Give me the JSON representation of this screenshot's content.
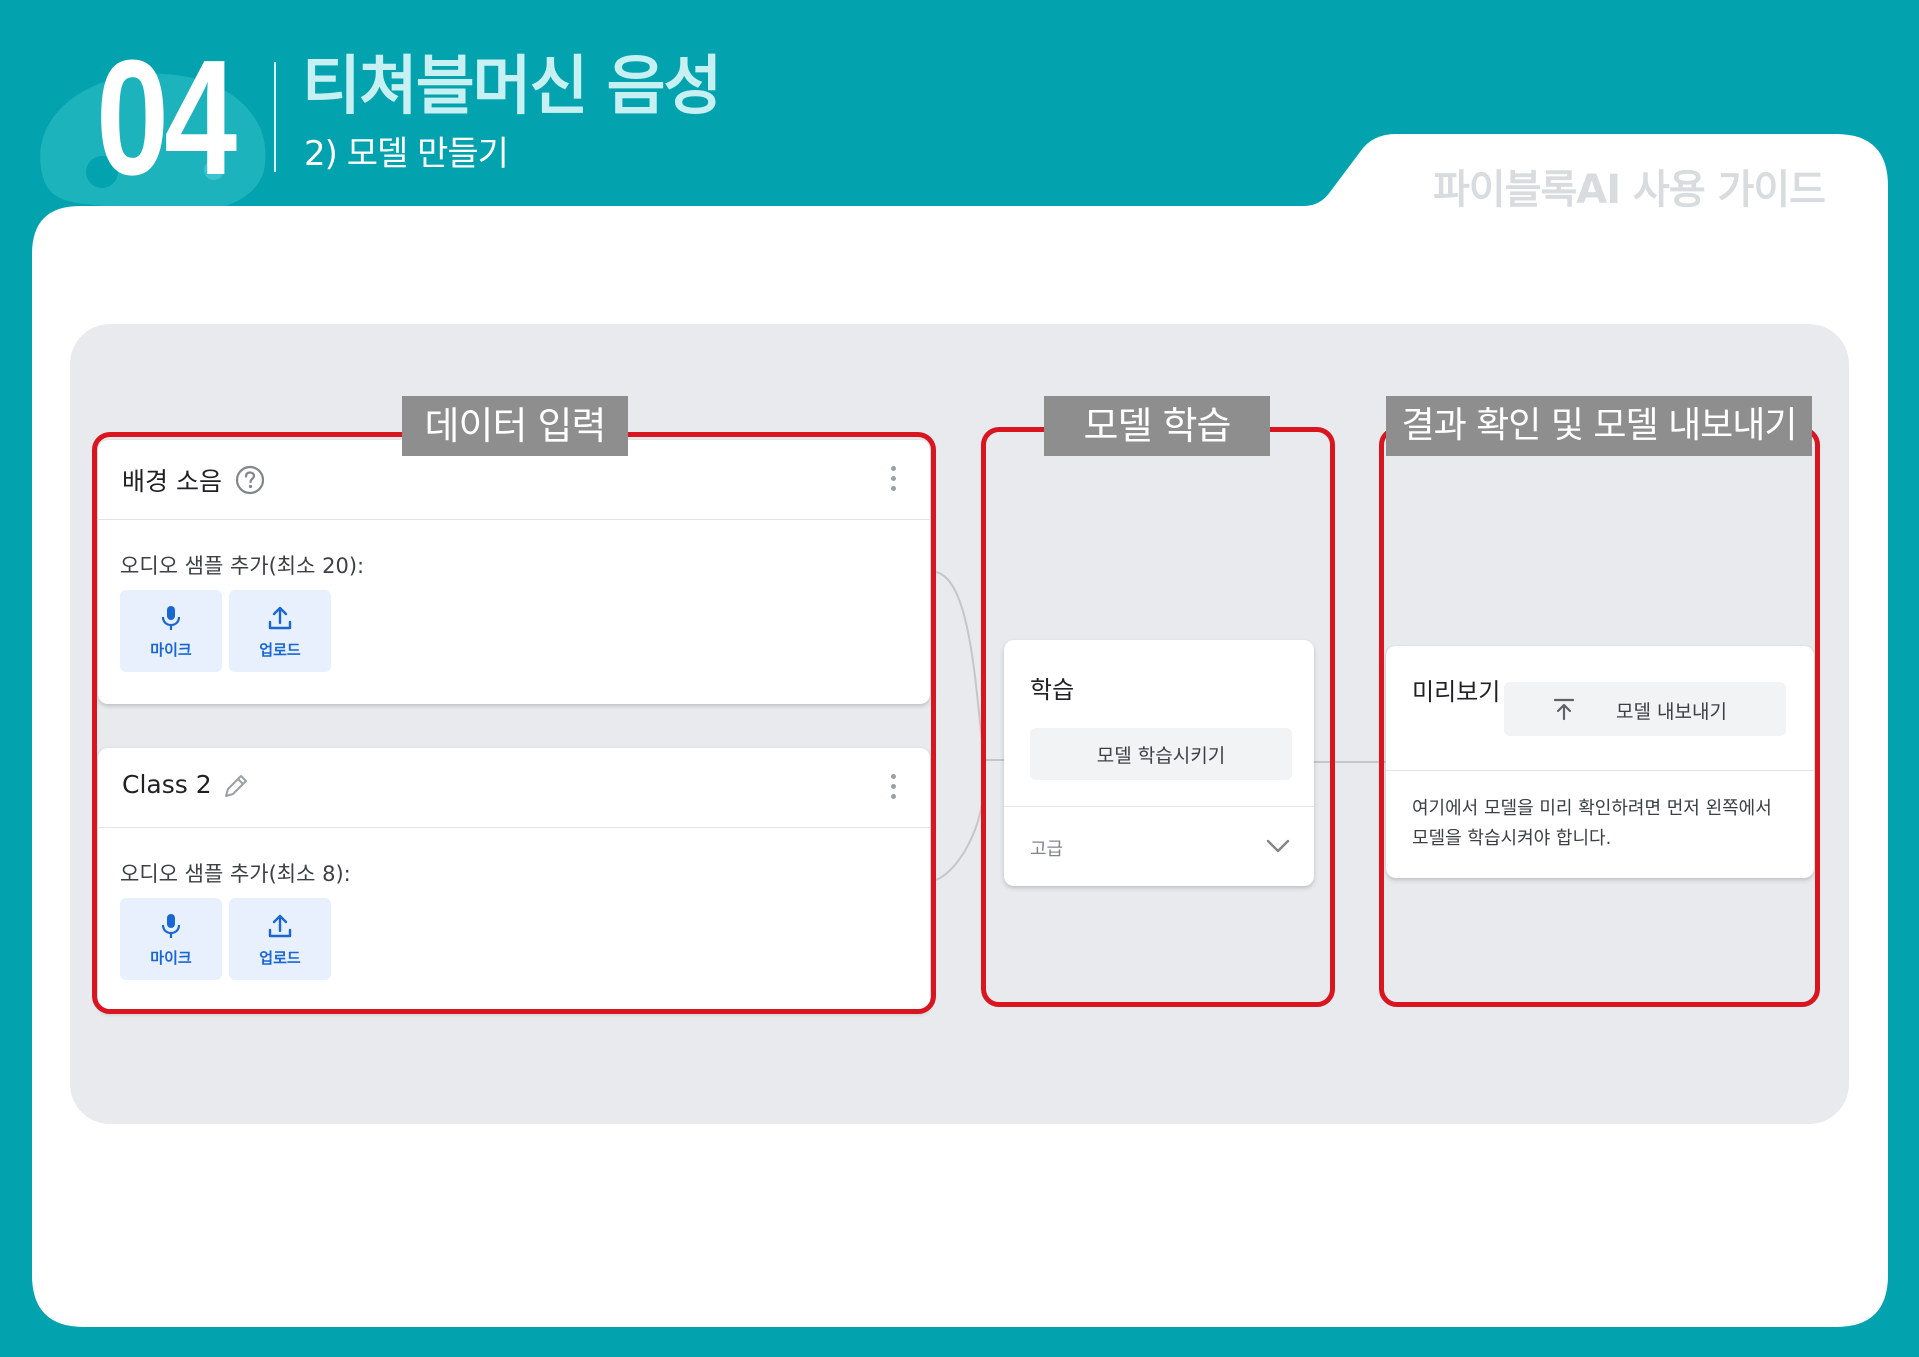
{
  "header": {
    "chapter_number": "04",
    "title": "티쳐블머신 음성",
    "subtitle": "2) 모델 만들기",
    "guide_label": "파이블록AI 사용 가이드"
  },
  "colors": {
    "background": "#02a2ae",
    "highlight_frame": "#d9151f",
    "label_box": "#8e8e8e",
    "button_accent": "#1967d2"
  },
  "sections": {
    "data_input": "데이터 입력",
    "training": "모델 학습",
    "result": "결과 확인 및 모델 내보내기"
  },
  "classes": [
    {
      "name": "배경 소음",
      "name_icon": "help-circle-icon",
      "sample_label": "오디오 샘플 추가(최소 20):",
      "mic_label": "마이크",
      "upload_label": "업로드"
    },
    {
      "name": "Class 2",
      "name_icon": "pencil-icon",
      "sample_label": "오디오 샘플 추가(최소 8):",
      "mic_label": "마이크",
      "upload_label": "업로드"
    }
  ],
  "training": {
    "title": "학습",
    "train_button": "모델 학습시키기",
    "advanced_label": "고급"
  },
  "preview": {
    "title": "미리보기",
    "export_button": "모델 내보내기",
    "description": "여기에서 모델을 미리 확인하려면 먼저 왼쪽에서 모델을 학습시켜야 합니다."
  }
}
